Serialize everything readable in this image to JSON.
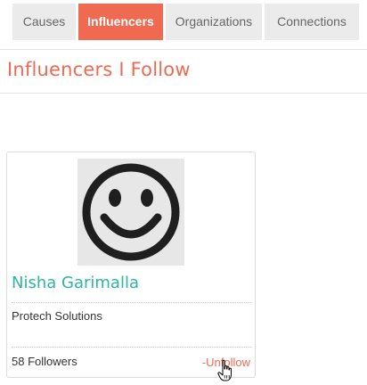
{
  "tabs": [
    {
      "label": "Causes",
      "active": false
    },
    {
      "label": "Influencers",
      "active": true
    },
    {
      "label": "Organizations",
      "active": false
    },
    {
      "label": "Connections",
      "active": false
    }
  ],
  "page": {
    "title": "Influencers I Follow"
  },
  "colors": {
    "accent": "#f06a51",
    "name": "#2bb5a4",
    "tab_bg": "#ebebeb"
  },
  "card": {
    "avatar_icon": "smiley-face-icon",
    "name": "Nisha Garimalla",
    "organization": "Protech Solutions",
    "followers": "58 Followers",
    "unfollow_label": "-Unfollow"
  },
  "cursor": "hand-pointer-icon"
}
